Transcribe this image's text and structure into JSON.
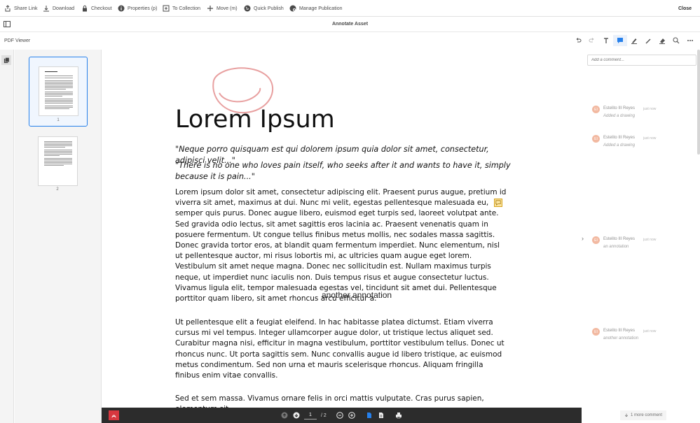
{
  "toolbar": {
    "items": [
      {
        "label": "Share Link",
        "icon": "share-icon"
      },
      {
        "label": "Download",
        "icon": "download-icon"
      },
      {
        "label": "Checkout",
        "icon": "lock-icon"
      },
      {
        "label": "Properties (p)",
        "icon": "info-icon"
      },
      {
        "label": "To Collection",
        "icon": "collection-icon"
      },
      {
        "label": "Move (m)",
        "icon": "move-icon"
      },
      {
        "label": "Quick Publish",
        "icon": "globe-icon"
      },
      {
        "label": "Manage Publication",
        "icon": "globe-gear-icon"
      }
    ],
    "close_label": "Close"
  },
  "header": {
    "title": "Annotate Asset"
  },
  "viewer": {
    "label": "PDF Viewer",
    "tools": [
      "undo-icon",
      "redo-icon",
      "text-icon",
      "comment-icon",
      "highlight-icon",
      "pen-icon",
      "eraser-icon",
      "search-icon",
      "more-icon"
    ]
  },
  "thumbnails": [
    {
      "page": "1",
      "selected": true
    },
    {
      "page": "2",
      "selected": false
    }
  ],
  "document": {
    "title": "Lorem Ipsum",
    "quote1": "\"Neque porro quisquam est qui dolorem ipsum quia dolor sit amet, consectetur, adipisci velit...\"",
    "quote2": "\"There is no one who loves pain itself, who seeks after it and wants to have it, simply because it is pain...\"",
    "para1": "Lorem ipsum dolor sit amet, consectetur adipiscing elit. Praesent purus augue, pretium id viverra sit amet, maximus at dui. Nunc mi velit, egestas pellentesque malesuada eu, semper quis purus. Donec augue libero, euismod eget turpis sed, laoreet volutpat ante. Sed gravida odio lectus, sit amet sagittis eros lacinia ac. Praesent venenatis quam in posuere fermentum. Ut congue tellus finibus metus mollis, nec sodales massa sagittis. Donec gravida tortor eros, at blandit quam fermentum imperdiet. Nunc elementum, nisl ut pellentesque auctor, mi risus lobortis mi, ac ultricies quam augue eget lorem. Vestibulum sit amet neque magna. Donec nec sollicitudin est. Nullam maximus turpis neque, ut imperdiet nunc iaculis non. Duis tempus risus et augue consectetur luctus. Vivamus ligula elit, tempor malesuada egestas vel, tincidunt sit amet dui. Pellentesque porttitor quam libero, sit amet rhoncus arcu efficitur a.",
    "floating_annotation": "another annotation",
    "para2": "Ut pellentesque elit a feugiat eleifend. In hac habitasse platea dictumst. Etiam viverra cursus mi vel tempus. Integer ullamcorper augue dolor, ut tristique lectus aliquet sed. Curabitur magna nisi, efficitur in magna vestibulum, porttitor vestibulum tellus. Donec ut rhoncus nunc. Ut porta sagittis sem. Nunc convallis augue id libero tristique, ac euismod metus condimentum. Sed non urna et mauris scelerisque rhoncus. Aliquam fringilla finibus enim vitae convallis.",
    "para3": "Sed et sem massa. Vivamus ornare felis in orci mattis vulputate. Cras purus sapien, elementum sit"
  },
  "pager": {
    "current": "1",
    "total": "/ 2"
  },
  "comments": {
    "placeholder": "Add a comment...",
    "items": [
      {
        "initials": "EI",
        "author": "Estelito III Reyes",
        "time": "just now",
        "body": "Added a drawing"
      },
      {
        "initials": "EI",
        "author": "Estelito III Reyes",
        "time": "just now",
        "body": "Added a drawing"
      },
      {
        "initials": "EI",
        "author": "Estelito III Reyes",
        "time": "just now",
        "body": "an annotation"
      },
      {
        "initials": "EI",
        "author": "Estelito III Reyes",
        "time": "just now",
        "body": "another annotation"
      }
    ],
    "more_label": "1 more comment"
  },
  "colors": {
    "accent": "#2680eb",
    "scribble": "#e8a0a0",
    "pdf_red": "#d7373f",
    "bottom_bar": "#2c2c2c"
  }
}
